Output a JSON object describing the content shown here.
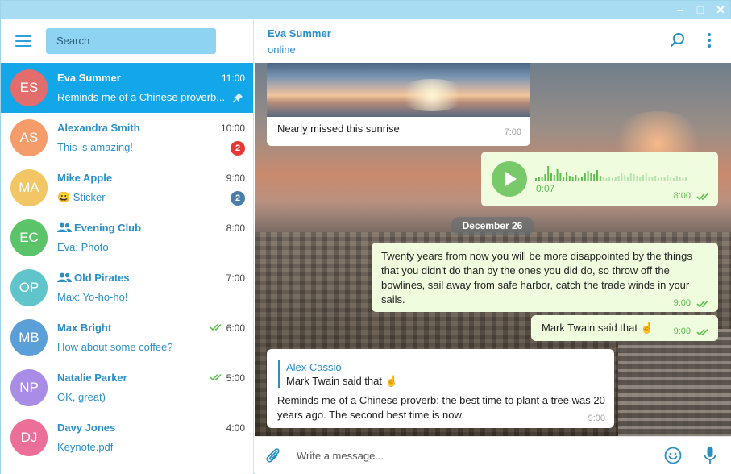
{
  "window": {
    "controls": [
      "–",
      "□",
      "✕"
    ]
  },
  "sidebar": {
    "search_placeholder": "Search",
    "chats": [
      {
        "initials": "ES",
        "name": "Eva Summer",
        "time": "11:00",
        "preview": "Reminds me of a Chinese proverb...",
        "color": "#e36d6d",
        "pinned": true,
        "active": true
      },
      {
        "initials": "AS",
        "name": "Alexandra Smith",
        "time": "10:00",
        "preview": "This is amazing!",
        "color": "#f59c6b",
        "badge": "2",
        "badge_color": "#e53935"
      },
      {
        "initials": "MA",
        "name": "Mike Apple",
        "time": "9:00",
        "preview": "😀 Sticker",
        "color": "#f2c565",
        "badge": "2",
        "badge_color": "#4a7ea8"
      },
      {
        "initials": "EC",
        "name": "Evening Club",
        "time": "8:00",
        "sender": "Eva:",
        "preview": "Photo",
        "color": "#5bc46b",
        "group": true
      },
      {
        "initials": "OP",
        "name": "Old Pirates",
        "time": "7:00",
        "sender": "Max:",
        "preview": "Yo-ho-ho!",
        "color": "#5fc5cb",
        "group": true
      },
      {
        "initials": "MB",
        "name": "Max Bright",
        "time": "6:00",
        "preview": "How about some coffee?",
        "color": "#5b9fd9",
        "read": true
      },
      {
        "initials": "NP",
        "name": "Natalie Parker",
        "time": "5:00",
        "preview": "OK, great)",
        "color": "#a88ce6",
        "read": true
      },
      {
        "initials": "DJ",
        "name": "Davy Jones",
        "time": "4:00",
        "preview": "Keynote.pdf",
        "color": "#ec6f9a"
      }
    ]
  },
  "header": {
    "name": "Eva Summer",
    "status": "online"
  },
  "messages": {
    "photo_caption": "Nearly missed this sunrise",
    "photo_time": "7:00",
    "voice_duration": "0:07",
    "voice_time": "8:00",
    "date_divider": "December 26",
    "quote_text": "Twenty years from now you will be more disappointed by the things that you didn't do than by the ones you did do, so throw off the bowlines, sail away from safe harbor, catch the trade winds in your sails.",
    "quote_time": "9:00",
    "short_text": "Mark Twain said that ☝️",
    "short_time": "9:00",
    "reply_name": "Alex Cassio",
    "reply_quote": "Mark Twain said that ☝️",
    "reply_body": "Reminds me of a Chinese proverb: the best time to plant a tree was 20 years ago. The second best time is now.",
    "reply_time": "9:00"
  },
  "composer": {
    "placeholder": "Write a message..."
  },
  "colors": {
    "accent": "#2a8fc8",
    "active_row": "#13a6e8",
    "titlebar": "#a8dcf3",
    "outgoing_bubble": "#effdde",
    "read_check": "#5cbf4e"
  }
}
